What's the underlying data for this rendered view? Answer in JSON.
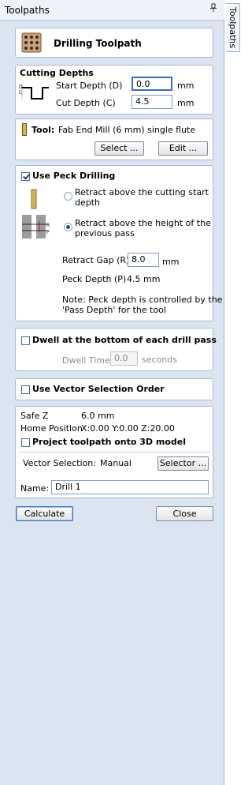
{
  "panel": {
    "title": "Toolpaths",
    "side_tab": "Toolpaths"
  },
  "header": {
    "title": "Drilling Toolpath"
  },
  "cutting_depths": {
    "heading": "Cutting Depths",
    "start_label": "Start Depth (D)",
    "start_value": "0.0",
    "start_unit": "mm",
    "cut_label": "Cut Depth (C)",
    "cut_value": "4.5",
    "cut_unit": "mm",
    "diagram_labels": {
      "d": "D",
      "c": "C"
    }
  },
  "tool": {
    "label": "Tool:",
    "name": "Fab End Mill (6 mm) single flute",
    "select_label": "Select ...",
    "edit_label": "Edit ..."
  },
  "peck": {
    "checkbox_label": "Use Peck Drilling",
    "checked": true,
    "option1": "Retract above the cutting start depth",
    "option1_line1": "Retract above the cutting start",
    "option1_line2": "depth",
    "option2_line1": "Retract above the height of the",
    "option2_line2": "previous pass",
    "selected_option": 2,
    "retract_gap_label": "Retract Gap (R)",
    "retract_gap_value": "8.0",
    "retract_gap_unit": "mm",
    "peck_depth_label": "Peck Depth (P)",
    "peck_depth_value": "4.5 mm",
    "note_line1": "Note: Peck depth is controlled by the",
    "note_line2": "'Pass Depth' for the tool",
    "diagram_labels": {
      "r": "R",
      "p": "P"
    }
  },
  "dwell": {
    "checkbox_label": "Dwell at the bottom of each drill pass",
    "checked": false,
    "time_label": "Dwell Time",
    "time_value": "0.0",
    "time_unit": "seconds"
  },
  "vector_order": {
    "checkbox_label": "Use Vector Selection Order",
    "checked": false
  },
  "info": {
    "safe_z_label": "Safe Z",
    "safe_z_value": "6.0 mm",
    "home_label": "Home Position",
    "home_value": "X:0.00 Y:0.00 Z:20.00",
    "project_label": "Project toolpath onto 3D model",
    "project_checked": false,
    "vector_selection_label": "Vector Selection:",
    "vector_selection_value": "Manual",
    "selector_label": "Selector ...",
    "name_label": "Name:",
    "name_value": "Drill 1"
  },
  "actions": {
    "calculate_label": "Calculate",
    "close_label": "Close"
  }
}
